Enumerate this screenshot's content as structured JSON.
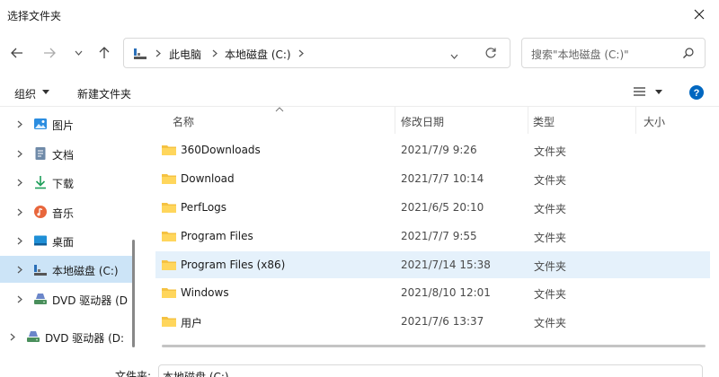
{
  "window": {
    "title": "选择文件夹"
  },
  "address": {
    "crumbs": [
      "此电脑",
      "本地磁盘 (C:)"
    ]
  },
  "search": {
    "placeholder": "搜索\"本地磁盘 (C:)\""
  },
  "commands": {
    "organize": "组织",
    "new_folder": "新建文件夹"
  },
  "sidebar": {
    "items": [
      {
        "label": "图片",
        "icon": "pictures-icon"
      },
      {
        "label": "文档",
        "icon": "documents-icon"
      },
      {
        "label": "下载",
        "icon": "downloads-icon"
      },
      {
        "label": "音乐",
        "icon": "music-icon"
      },
      {
        "label": "桌面",
        "icon": "desktop-icon"
      },
      {
        "label": "本地磁盘 (C:)",
        "icon": "drive-icon"
      },
      {
        "label": "DVD 驱动器 (D",
        "icon": "dvd-drive-icon"
      },
      {
        "label": "DVD 驱动器 (D:",
        "icon": "dvd-drive-icon"
      }
    ]
  },
  "columns": {
    "name": "名称",
    "date": "修改日期",
    "type": "类型",
    "size": "大小"
  },
  "files": [
    {
      "name": "360Downloads",
      "date": "2021/7/9 9:26",
      "type": "文件夹"
    },
    {
      "name": "Download",
      "date": "2021/7/7 10:14",
      "type": "文件夹"
    },
    {
      "name": "PerfLogs",
      "date": "2021/6/5 20:10",
      "type": "文件夹"
    },
    {
      "name": "Program Files",
      "date": "2021/7/7 9:55",
      "type": "文件夹"
    },
    {
      "name": "Program Files (x86)",
      "date": "2021/7/14 15:38",
      "type": "文件夹"
    },
    {
      "name": "Windows",
      "date": "2021/8/10 12:01",
      "type": "文件夹"
    },
    {
      "name": "用户",
      "date": "2021/7/6 13:37",
      "type": "文件夹"
    }
  ],
  "footer": {
    "folder_label": "文件夹:",
    "folder_value": "本地磁盘 (C:)"
  },
  "colors": {
    "selection": "#cce4f7",
    "row_selected": "#e5f1fb",
    "folder": "#f5c242",
    "help": "#0067c0"
  }
}
